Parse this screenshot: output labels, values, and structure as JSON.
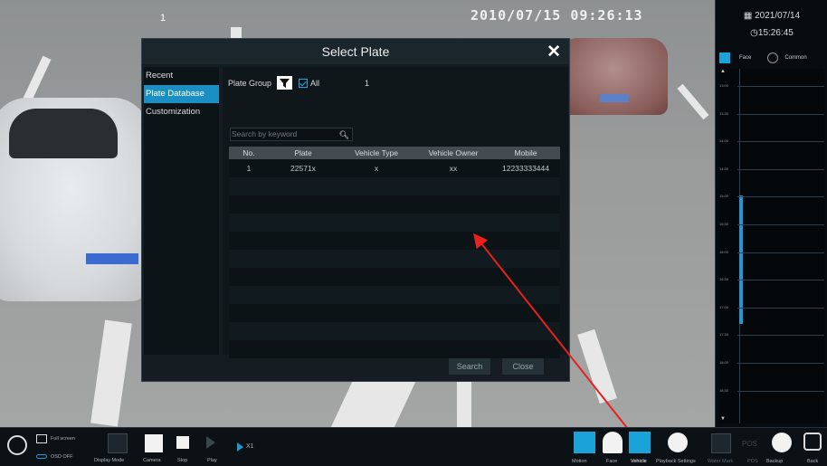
{
  "camera": {
    "timestamp": "2010/07/15 09:26:13",
    "channel": "1"
  },
  "right_panel": {
    "date": "2021/07/14",
    "time": "15:26:45",
    "tabs": [
      "Face",
      "Common"
    ],
    "timeline_ticks": [
      "13:00",
      "13:30",
      "14:00",
      "14:30",
      "15:00",
      "15:30",
      "16:00",
      "16:30",
      "17:00",
      "17:30",
      "18:00",
      "18:30"
    ]
  },
  "dialog": {
    "title": "Select Plate",
    "nav": [
      "Recent",
      "Plate Database",
      "Customization"
    ],
    "active_nav": "Plate Database",
    "plate_group_label": "Plate Group",
    "all_label": "All",
    "count": "1",
    "search_placeholder": "Search by keyword",
    "columns": [
      "No.",
      "Plate",
      "Vehicle Type",
      "Vehicle Owner",
      "Mobile"
    ],
    "rows": [
      [
        "1",
        "22571x",
        "x",
        "xx",
        "12233333444"
      ]
    ],
    "search_button": "Search",
    "close_button": "Close"
  },
  "bottombar": {
    "full_screen": "Full screen",
    "osd_off": "OSD OFF",
    "display_mode": "Display Mode",
    "camera": "Camera",
    "stop": "Stop",
    "play": "Play",
    "speed": "X1",
    "motion": "Motion",
    "face": "Face",
    "vehicle": "Vehicle",
    "playback_settings": "Playback Settings",
    "water_mark": "Water Mark",
    "pos": "POS",
    "backup": "Backup",
    "back": "Back"
  },
  "colors": {
    "accent": "#1b8fc4",
    "annotation_arrow": "#e8211c"
  }
}
